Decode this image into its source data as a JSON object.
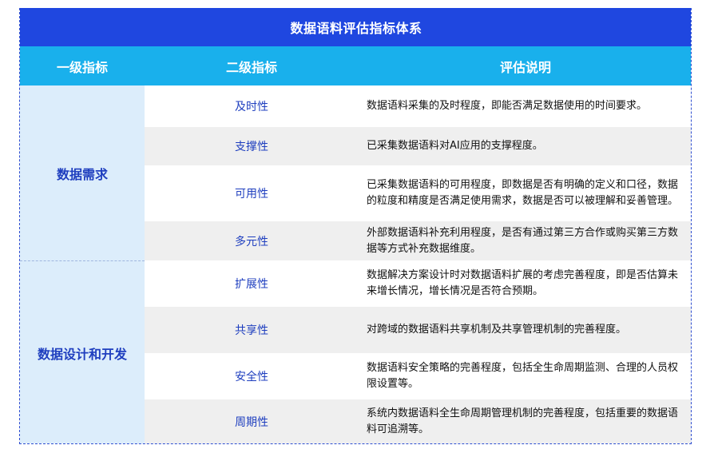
{
  "table": {
    "title": "数据语料评估指标体系",
    "headers": {
      "level1": "一级指标",
      "level2": "二级指标",
      "description": "评估说明"
    },
    "groups": [
      {
        "name": "数据需求",
        "rows": [
          {
            "level2": "及时性",
            "description": "数据语料采集的及时程度，即能否满足数据使用的时间要求。"
          },
          {
            "level2": "支撑性",
            "description": "已采集数据语料对AI应用的支撑程度。"
          },
          {
            "level2": "可用性",
            "description": "已采集数据语料的可用程度，即数据是否有明确的定义和口径，数据的粒度和精度是否满足使用需求，数据是否可以被理解和妥善管理。"
          },
          {
            "level2": "多元性",
            "description": "外部数据语料补充利用程度，是否有通过第三方合作或购买第三方数据等方式补充数据维度。"
          }
        ]
      },
      {
        "name": "数据设计和开发",
        "rows": [
          {
            "level2": "扩展性",
            "description": "数据解决方案设计时对数据语料扩展的考虑完善程度，即是否估算未来增长情况，增长情况是否符合预期。"
          },
          {
            "level2": "共享性",
            "description": "对跨域的数据语料共享机制及共享管理机制的完善程度。"
          },
          {
            "level2": "安全性",
            "description": "数据语料安全策略的完善程度，包括全生命周期监测、合理的人员权限设置等。"
          },
          {
            "level2": "周期性",
            "description": "系统内数据语料全生命周期管理机制的完善程度，包括重要的数据语料可追溯等。"
          }
        ]
      }
    ]
  },
  "colors": {
    "title_bg": "#1f47e0",
    "header_bg": "#19b0ec",
    "level1_bg": "#dcedfb",
    "accent_text": "#1f3fbf",
    "alt_row_bg": "#efefef"
  }
}
